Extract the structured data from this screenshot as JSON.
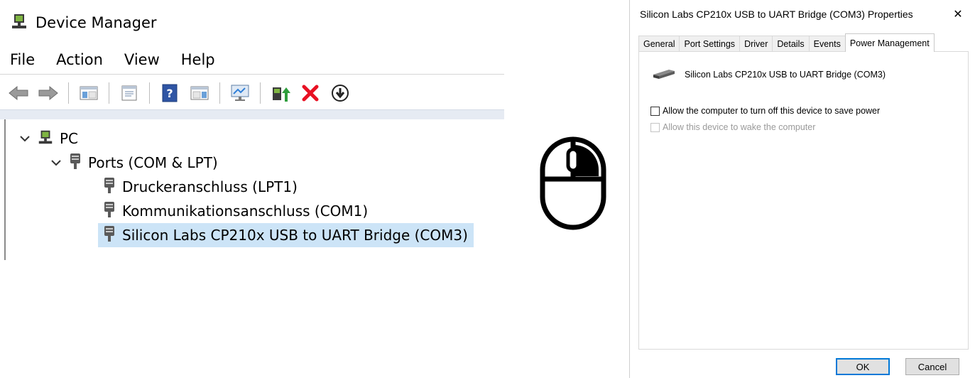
{
  "device_manager": {
    "title": "Device Manager",
    "menu": [
      "File",
      "Action",
      "View",
      "Help"
    ],
    "toolbar_icons": [
      "back-arrow-icon",
      "forward-arrow-icon",
      "show-hide-console-tree-icon",
      "properties-icon",
      "help-icon",
      "action-pane-icon",
      "monitor-icon",
      "update-driver-icon",
      "uninstall-x-icon",
      "download-circle-icon"
    ],
    "tree": {
      "root": "PC",
      "category": "Ports (COM & LPT)",
      "items": [
        "Druckeranschluss (LPT1)",
        "Kommunikationsanschluss (COM1)",
        "Silicon Labs CP210x USB to UART Bridge (COM3)"
      ],
      "selected_index": 2
    },
    "colors": {
      "selection": "#cce4f7",
      "uninstall": "#e81123",
      "update": "#2e9d3c"
    }
  },
  "mouse_hint": {
    "icon": "mouse-right-click-icon"
  },
  "properties_dialog": {
    "title": "Silicon Labs CP210x USB to UART Bridge (COM3) Properties",
    "close_glyph": "✕",
    "tabs": [
      "General",
      "Port Settings",
      "Driver",
      "Details",
      "Events",
      "Power Management"
    ],
    "active_tab": "Power Management",
    "device_name": "Silicon Labs CP210x USB to UART Bridge (COM3)",
    "options": [
      {
        "label": "Allow the computer to turn off this device to save power",
        "checked": false,
        "enabled": true
      },
      {
        "label": "Allow this device to wake the computer",
        "checked": false,
        "enabled": false
      }
    ],
    "buttons": {
      "ok": "OK",
      "cancel": "Cancel"
    }
  }
}
